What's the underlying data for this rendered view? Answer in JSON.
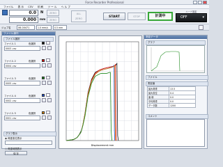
{
  "window": {
    "title": "Force Recorder Professional"
  },
  "menu": [
    "ファイル",
    "表 示",
    "CSV",
    "印 刷",
    "ツ ー ル",
    "ヘ ル プ"
  ],
  "readouts": [
    {
      "value": "0.0",
      "unit": "N"
    },
    {
      "value": "0.000",
      "unit": "mm"
    }
  ],
  "buttons": {
    "zero1": "ZERO",
    "zero2": "ZERO",
    "all_zero": "ALL\nZERO",
    "start": "START",
    "stop": "STOP",
    "measure": "計測中",
    "mode_label": "ハード設定",
    "mode_value": "OFF"
  },
  "control_bar": {
    "name_label": "ジョブ名",
    "name_value": "06-00471",
    "field2": "1.0 mm/s",
    "field3": "0.5 mm"
  },
  "left_panel": {
    "title": "ファイル操作",
    "section": "ファイル選択",
    "files": [
      {
        "label": "ファイル 1",
        "color_label": "色選択",
        "color": "#111111",
        "val": "0003 .csv"
      },
      {
        "label": "ファイル 2",
        "color_label": "色選択",
        "color": "#e81010",
        "val": "0004 .csv"
      },
      {
        "label": "ファイル 3",
        "color_label": "色選択",
        "color": "#1d8a1d",
        "val": "0005 .csv"
      },
      {
        "label": "ファイル 4",
        "color_label": "色選択",
        "color": "#1c4ed8",
        "val": "0002 .csv"
      },
      {
        "label": "ファイル 5",
        "color_label": "色選択",
        "color": "#e08a10",
        "val": "0001 .csv"
      }
    ],
    "section2": "グラフ表示",
    "radio1": "荷重変位表示",
    "radio2": "荷重時間表示",
    "bottom_btn": "保 存"
  },
  "right_panel": {
    "title": "測定データ",
    "sub1": "グラフ",
    "sub2": "ファイル",
    "sub3": "測定値",
    "rows": [
      {
        "k": "最大荷重",
        "v": "13.5"
      },
      {
        "k": "最大変位",
        "v": "0.4"
      },
      {
        "k": "面 積",
        "v": "0.0"
      },
      {
        "k": "平均荷重",
        "v": "0.0"
      },
      {
        "k": "データ数",
        "v": "1200"
      }
    ],
    "sub4": "コメント"
  },
  "graph": {
    "xlabel": "Displacement mm"
  },
  "chart_data": {
    "type": "line",
    "series": [
      {
        "color": "#111111",
        "x": [
          0,
          10,
          15,
          18,
          20,
          21,
          23,
          26,
          30,
          35,
          40,
          45,
          48,
          52,
          58,
          64,
          68,
          70,
          70.5,
          71,
          72
        ],
        "y": [
          0,
          1,
          3,
          6,
          9,
          10,
          16,
          28,
          48,
          62,
          69,
          71,
          72,
          73,
          74,
          75,
          76,
          78,
          40,
          5,
          0
        ]
      },
      {
        "color": "#e81010",
        "x": [
          0,
          10,
          15,
          18,
          20,
          21,
          23,
          26,
          30,
          35,
          40,
          45,
          48,
          52,
          58,
          64,
          67,
          68,
          68.5,
          69
        ],
        "y": [
          0,
          1,
          3,
          6,
          8,
          10,
          16,
          27,
          47,
          61,
          68,
          71,
          72,
          73,
          74,
          75,
          76,
          77,
          20,
          0
        ]
      },
      {
        "color": "#1c4ed8",
        "x": [
          0,
          10,
          15,
          18,
          20,
          21,
          23,
          26,
          30,
          35,
          40,
          45,
          48,
          52,
          58,
          62,
          65,
          66,
          66.5,
          67
        ],
        "y": [
          0,
          1,
          3,
          6,
          8,
          10,
          16,
          27,
          46,
          60,
          67,
          70,
          71,
          72,
          73,
          74,
          75,
          76,
          10,
          0
        ]
      },
      {
        "color": "#e08a10",
        "x": [
          0,
          10,
          15,
          18,
          20,
          21,
          23,
          26,
          30,
          35,
          40,
          45,
          48,
          52,
          58,
          63,
          66,
          67,
          67.5,
          68
        ],
        "y": [
          0,
          1,
          3,
          6,
          8,
          10,
          16,
          27,
          46,
          60,
          67,
          70,
          71,
          72,
          73,
          74,
          75,
          76,
          15,
          0
        ]
      },
      {
        "color": "#1d8a1d",
        "x": [
          0,
          10,
          15,
          18,
          20,
          21,
          23,
          26,
          30,
          35,
          40,
          45,
          48,
          52,
          56,
          60,
          61,
          62,
          63
        ],
        "y": [
          0,
          1,
          3,
          6,
          8,
          10,
          15,
          25,
          44,
          58,
          65,
          67,
          68,
          68,
          68,
          69,
          69,
          10,
          0
        ]
      }
    ],
    "xlim": [
      0,
      100
    ],
    "ylim": [
      0,
      100
    ]
  }
}
